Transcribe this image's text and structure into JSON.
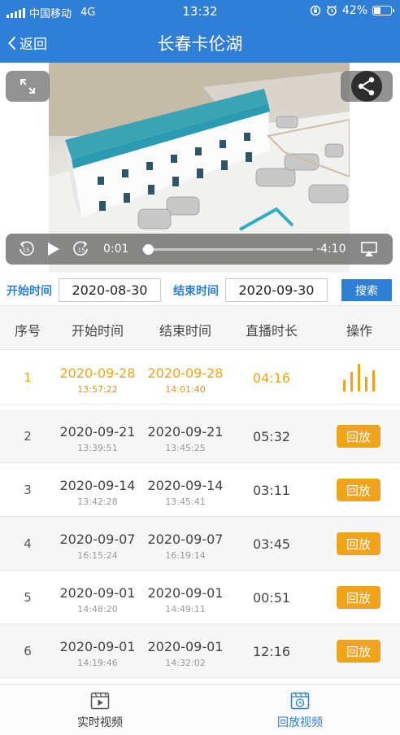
{
  "status_bar": {
    "carrier": "中国移动",
    "network": "4G",
    "time": "13:32",
    "battery_text": "42%",
    "battery_level": 0.42
  },
  "nav": {
    "back_label": "返回",
    "title": "长春卡伦湖"
  },
  "player": {
    "skip_back": "15",
    "skip_forward": "15",
    "elapsed": "0:01",
    "remaining": "-4:10",
    "progress": 0.004
  },
  "search": {
    "start_label": "开始时间",
    "start_value": "2020-08-30",
    "end_label": "结束时间",
    "end_value": "2020-09-30",
    "button_label": "搜索"
  },
  "table": {
    "headers": [
      "序号",
      "开始时间",
      "结束时间",
      "直播时长",
      "操作"
    ],
    "replay_label": "回放",
    "rows": [
      {
        "index": "1",
        "start_date": "2020-09-28",
        "start_time": "13:57:22",
        "end_date": "2020-09-28",
        "end_time": "14:01:40",
        "duration": "04:16",
        "action": "playing"
      },
      {
        "index": "2",
        "start_date": "2020-09-21",
        "start_time": "13:39:51",
        "end_date": "2020-09-21",
        "end_time": "13:45:25",
        "duration": "05:32",
        "action": "replay"
      },
      {
        "index": "3",
        "start_date": "2020-09-14",
        "start_time": "13:42:28",
        "end_date": "2020-09-14",
        "end_time": "13:45:41",
        "duration": "03:11",
        "action": "replay"
      },
      {
        "index": "4",
        "start_date": "2020-09-07",
        "start_time": "16:15:24",
        "end_date": "2020-09-07",
        "end_time": "16:19:14",
        "duration": "03:45",
        "action": "replay"
      },
      {
        "index": "5",
        "start_date": "2020-09-01",
        "start_time": "14:48:20",
        "end_date": "2020-09-01",
        "end_time": "14:49:11",
        "duration": "00:51",
        "action": "replay"
      },
      {
        "index": "6",
        "start_date": "2020-09-01",
        "start_time": "14:19:46",
        "end_date": "2020-09-01",
        "end_time": "14:32:02",
        "duration": "12:16",
        "action": "replay"
      }
    ]
  },
  "tabs": [
    {
      "label": "实时视频",
      "icon": "live-video-icon",
      "active": false
    },
    {
      "label": "回放视频",
      "icon": "replay-video-icon",
      "active": true
    }
  ],
  "colors": {
    "primary": "#2f7fd6",
    "accent": "#f0a41c"
  }
}
